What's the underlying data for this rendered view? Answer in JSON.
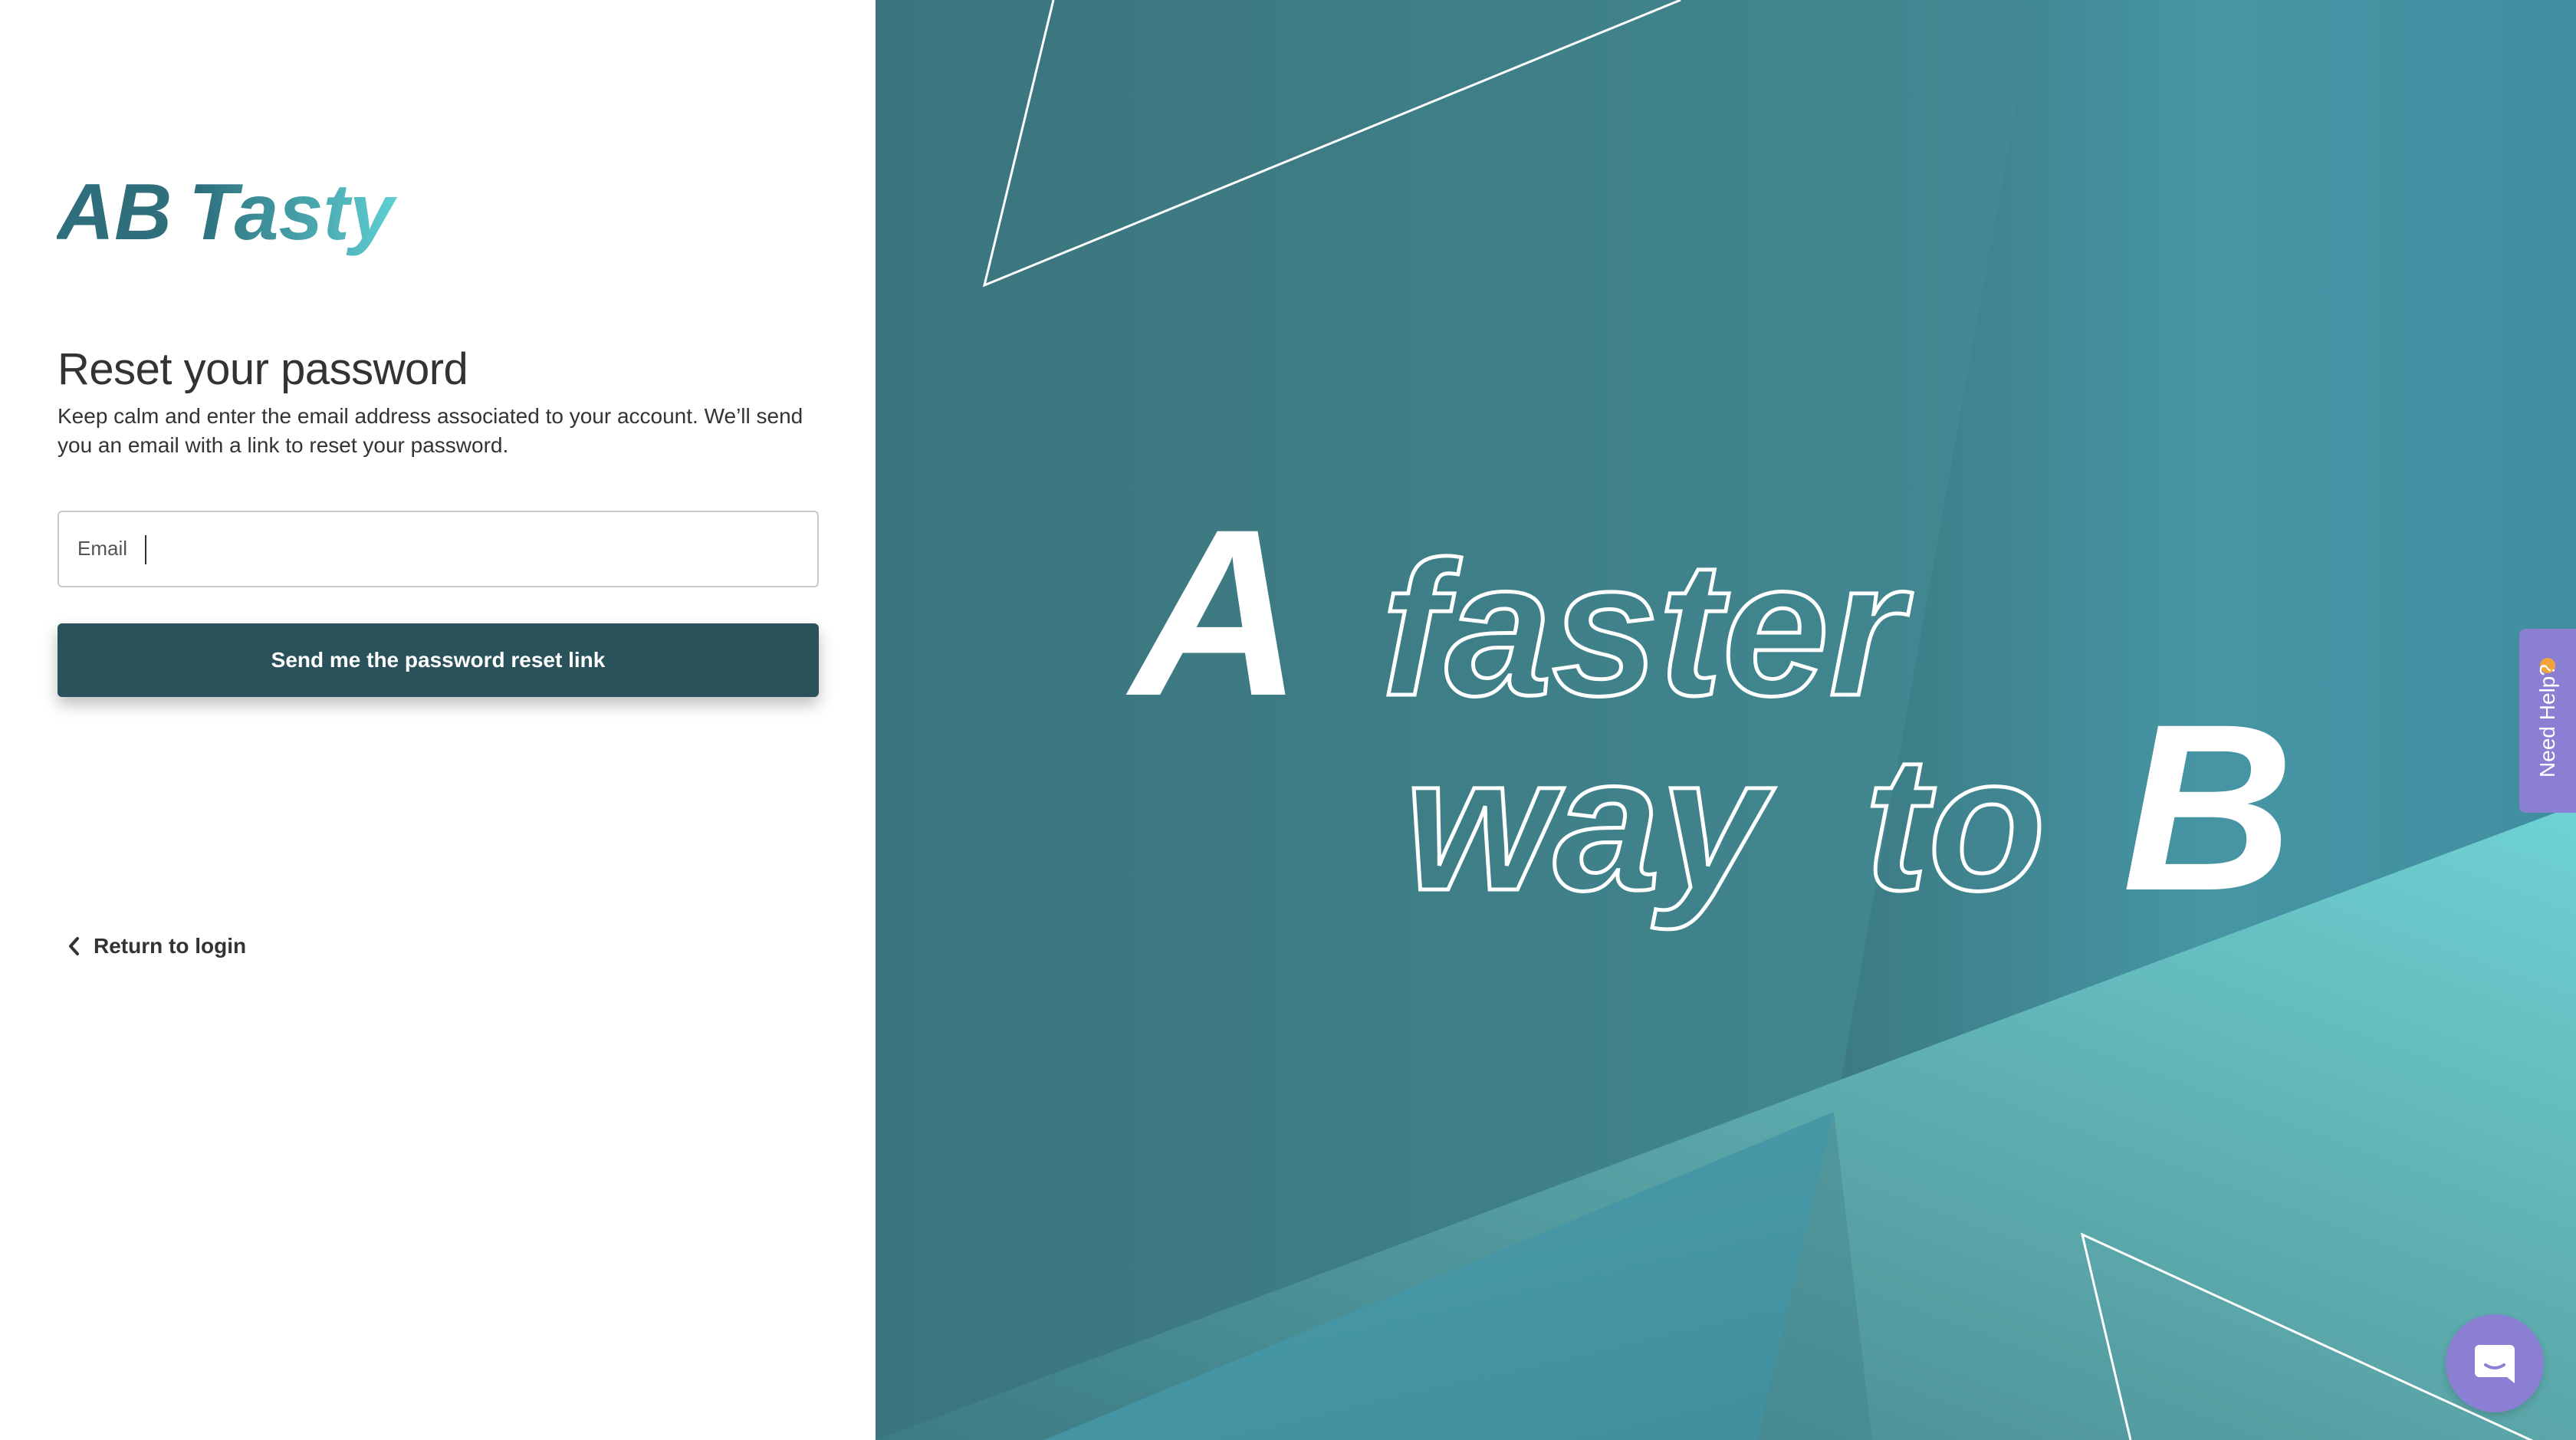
{
  "brand": {
    "logo_text_ab": "AB",
    "logo_text_tasty": "Tasty",
    "color_dark": "#2a525b",
    "color_light": "#5fc8cc"
  },
  "form": {
    "title": "Reset your password",
    "description": "Keep calm and enter the email address associated to your account. We’ll send you an email with a link to reset your password.",
    "email_label": "Email",
    "email_value": "",
    "submit_label": "Send me the password reset link",
    "return_label": "Return to login"
  },
  "hero": {
    "letter_a": "A",
    "word_faster": "faster",
    "word_way": "way",
    "word_to": "to",
    "letter_b": "B"
  },
  "widgets": {
    "help_label": "Need Help?",
    "help_emoji": "👍",
    "chat_icon": "chat-bubble-icon",
    "accent": "#8b7fd4"
  }
}
